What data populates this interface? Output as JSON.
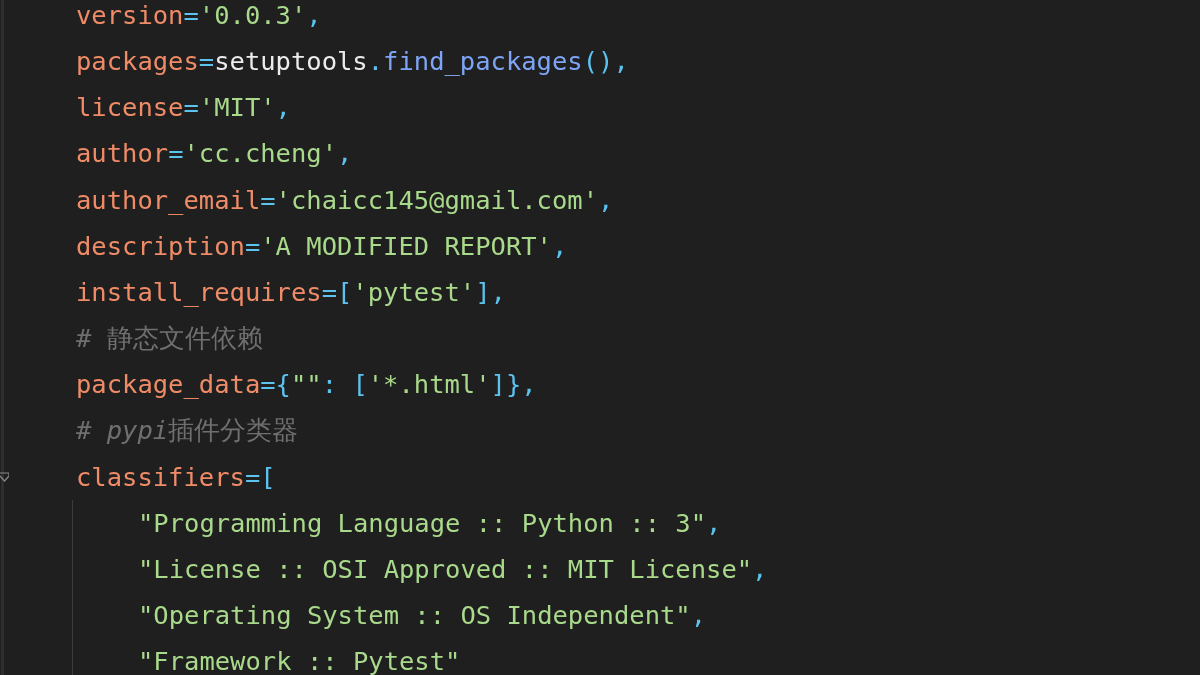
{
  "editor": {
    "lines": [
      {
        "tokens": [
          {
            "text": "version",
            "kind": "param"
          },
          {
            "text": "=",
            "kind": "op"
          },
          {
            "text": "'0.0.3'",
            "kind": "string"
          },
          {
            "text": ",",
            "kind": "op"
          }
        ]
      },
      {
        "tokens": [
          {
            "text": "packages",
            "kind": "param"
          },
          {
            "text": "=",
            "kind": "op"
          },
          {
            "text": "setuptools",
            "kind": "plain"
          },
          {
            "text": ".",
            "kind": "op"
          },
          {
            "text": "find_packages",
            "kind": "func"
          },
          {
            "text": "(),",
            "kind": "op"
          }
        ]
      },
      {
        "tokens": [
          {
            "text": "license",
            "kind": "param"
          },
          {
            "text": "=",
            "kind": "op"
          },
          {
            "text": "'MIT'",
            "kind": "string"
          },
          {
            "text": ",",
            "kind": "op"
          }
        ]
      },
      {
        "tokens": [
          {
            "text": "author",
            "kind": "param"
          },
          {
            "text": "=",
            "kind": "op"
          },
          {
            "text": "'cc.cheng'",
            "kind": "string"
          },
          {
            "text": ",",
            "kind": "op"
          }
        ]
      },
      {
        "tokens": [
          {
            "text": "author_email",
            "kind": "param"
          },
          {
            "text": "=",
            "kind": "op"
          },
          {
            "text": "'chaicc145@gmail.com'",
            "kind": "string"
          },
          {
            "text": ",",
            "kind": "op"
          }
        ]
      },
      {
        "tokens": [
          {
            "text": "description",
            "kind": "param"
          },
          {
            "text": "=",
            "kind": "op"
          },
          {
            "text": "'A MODIFIED REPORT'",
            "kind": "string"
          },
          {
            "text": ",",
            "kind": "op"
          }
        ]
      },
      {
        "tokens": [
          {
            "text": "install_requires",
            "kind": "param"
          },
          {
            "text": "=[",
            "kind": "op"
          },
          {
            "text": "'pytest'",
            "kind": "string"
          },
          {
            "text": "],",
            "kind": "op"
          }
        ]
      },
      {
        "tokens": [
          {
            "text": "# 静态文件依赖",
            "kind": "comment"
          }
        ]
      },
      {
        "tokens": [
          {
            "text": "package_data",
            "kind": "param"
          },
          {
            "text": "={",
            "kind": "op"
          },
          {
            "text": "\"\"",
            "kind": "string"
          },
          {
            "text": ": [",
            "kind": "op"
          },
          {
            "text": "'*.html'",
            "kind": "string"
          },
          {
            "text": "]},",
            "kind": "op"
          }
        ]
      },
      {
        "tokens": [
          {
            "text": "# ",
            "kind": "comment"
          },
          {
            "text": "pypi",
            "kind": "comment",
            "italic": true
          },
          {
            "text": "插件分类器",
            "kind": "comment"
          }
        ]
      },
      {
        "tokens": [
          {
            "text": "classifiers",
            "kind": "param"
          },
          {
            "text": "=[",
            "kind": "op"
          }
        ],
        "folded": false,
        "children": [
          {
            "tokens": [
              {
                "text": "\"Programming Language :: Python :: 3\"",
                "kind": "string"
              },
              {
                "text": ",",
                "kind": "op"
              }
            ]
          },
          {
            "tokens": [
              {
                "text": "\"License :: OSI Approved :: MIT License\"",
                "kind": "string"
              },
              {
                "text": ",",
                "kind": "op"
              }
            ]
          },
          {
            "tokens": [
              {
                "text": "\"Operating System :: OS Independent\"",
                "kind": "string"
              },
              {
                "text": ",",
                "kind": "op"
              }
            ]
          },
          {
            "tokens": [
              {
                "text": "\"Framework :: Pytest\"",
                "kind": "string"
              }
            ]
          }
        ]
      }
    ]
  }
}
